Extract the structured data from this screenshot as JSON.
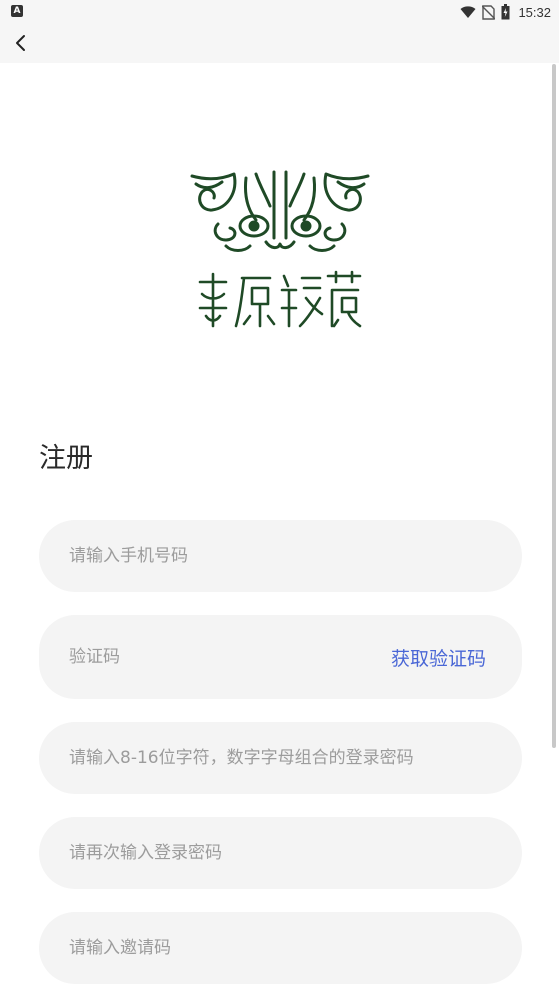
{
  "status_bar": {
    "left_icon": "A",
    "time": "15:32",
    "icons": [
      "wifi-icon",
      "no-sim-icon",
      "battery-icon"
    ]
  },
  "nav": {
    "back_icon": "chevron-left-icon"
  },
  "logo": {
    "text": "華原臻藏",
    "color": "#1f4a26"
  },
  "form": {
    "title": "注册",
    "phone_placeholder": "请输入手机号码",
    "code_placeholder": "验证码",
    "get_code_label": "获取验证码",
    "password_placeholder": "请输入8-16位字符，数字字母组合的登录密码",
    "confirm_password_placeholder": "请再次输入登录密码",
    "invite_placeholder": "请输入邀请码"
  },
  "colors": {
    "accent": "#4a67d6",
    "field_bg": "#f4f4f4",
    "placeholder": "#9c9c9c"
  }
}
